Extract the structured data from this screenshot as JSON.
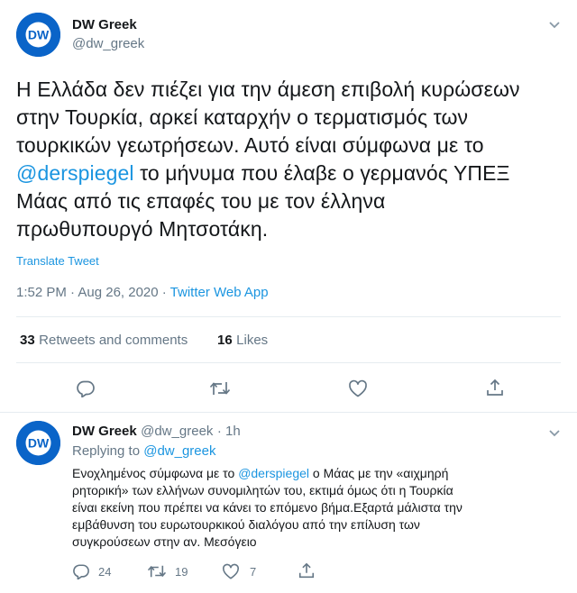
{
  "tweet": {
    "author_name": "DW Greek",
    "author_handle": "@dw_greek",
    "logo_text": "DW",
    "text_lines": [
      "Η Ελλάδα δεν πιέζει για την άμεση επιβολή κυρώσεων",
      "στην Τουρκία, αρκεί καταρχήν ο τερματισμός των",
      "τουρκικών γεωτρήσεων. Αυτό είναι σύμφωνα με το"
    ],
    "mention": "@derspiegel",
    "line4_rest": " το μήνυμα που έλαβε ο γερμανός ΥΠΕΞ",
    "line5": "Μάας από τις επαφές του με τον έλληνα",
    "line6": "πρωθυπουργό Μητσοτάκη.",
    "translate_label": "Translate Tweet",
    "time": "1:52 PM · Aug 26, 2020 · ",
    "source": "Twitter Web App",
    "retweets_count": "33",
    "retweets_label": "Retweets and comments",
    "likes_count": "16",
    "likes_label": "Likes"
  },
  "reply": {
    "author_name": "DW Greek",
    "author_handle": "@dw_greek",
    "age": "· 1h",
    "replying_prefix": "Replying to ",
    "replying_to": "@dw_greek",
    "line1_pre": "Ενοχλημένος σύμφωνα με το ",
    "line1_mention": "@derspiegel",
    "line1_post": " ο Μάας με την «αιχμηρή",
    "line2": "ρητορική» των ελλήνων συνομιλητών του, εκτιμά όμως ότι η Τουρκία",
    "line3": "είναι εκείνη που πρέπει να κάνει το επόμενο βήμα.Εξαρτά μάλιστα την",
    "line4": "εμβάθυνση του ευρωτουρκικού διαλόγου από την επίλυση των",
    "line5": "συγκρούσεων στην αν. Μεσόγειο",
    "reply_count": "24",
    "retweet_count": "19",
    "like_count": "7"
  },
  "colors": {
    "accent": "#1b95e0",
    "secondary_text": "#657786",
    "logo_blue": "#0a64c8",
    "divider": "#e6ecf0"
  },
  "icons": [
    "dw-logo-icon",
    "chevron-down-icon",
    "reply-icon",
    "retweet-icon",
    "like-icon",
    "share-icon"
  ]
}
